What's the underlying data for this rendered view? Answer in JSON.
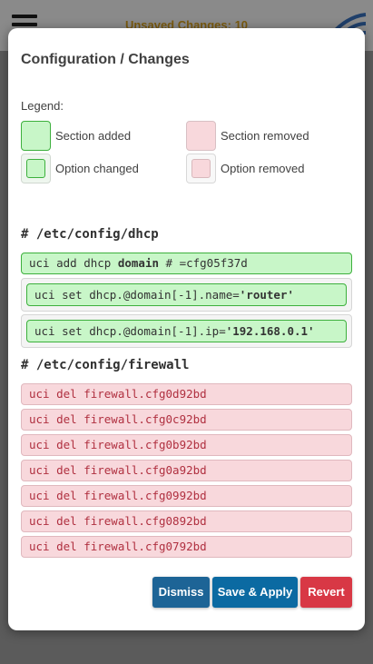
{
  "header": {
    "unsaved_label": "Unsaved Changes: 10"
  },
  "modal": {
    "title": "Configuration / Changes",
    "legend": {
      "title": "Legend:",
      "section_added": "Section added",
      "section_removed": "Section removed",
      "option_changed": "Option changed",
      "option_removed": "Option removed"
    },
    "dhcp": {
      "heading": "# /etc/config/dhcp",
      "add_prefix": "uci add dhcp ",
      "add_type": "domain",
      "add_suffix": " # =cfg05f37d",
      "opt1_prefix": "uci set dhcp.@domain[-1].name=",
      "opt1_value": "'router'",
      "opt2_prefix": "uci set dhcp.@domain[-1].ip=",
      "opt2_value": "'192.168.0.1'"
    },
    "firewall": {
      "heading": "# /etc/config/firewall",
      "del_prefix": "uci del firewall.",
      "removed": [
        "cfg0d92bd",
        "cfg0c92bd",
        "cfg0b92bd",
        "cfg0a92bd",
        "cfg0992bd",
        "cfg0892bd",
        "cfg0792bd"
      ]
    },
    "buttons": {
      "dismiss": "Dismiss",
      "save_apply": "Save & Apply",
      "revert": "Revert"
    }
  },
  "colors": {
    "added_bg": "#c8f6c8",
    "removed_bg": "#f8d8dc",
    "primary": "#0b6aa2",
    "danger": "#d83845"
  }
}
